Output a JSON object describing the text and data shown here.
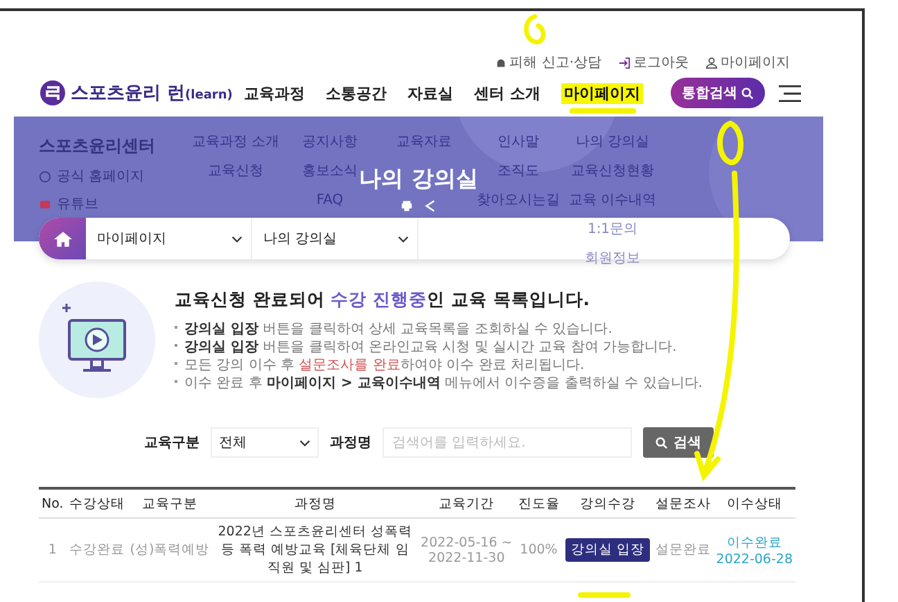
{
  "top_links": [
    {
      "label": "피해 신고·상담"
    },
    {
      "label": "로그아웃"
    },
    {
      "label": "마이페이지"
    }
  ],
  "logo": {
    "name": "스포츠윤리 런",
    "suffix": "(learn)"
  },
  "nav": [
    {
      "label": "교육과정",
      "selected": false
    },
    {
      "label": "소통공간",
      "selected": false
    },
    {
      "label": "자료실",
      "selected": false
    },
    {
      "label": "센터 소개",
      "selected": false
    },
    {
      "label": "마이페이지",
      "selected": true
    }
  ],
  "search_button": "통합검색",
  "banner": {
    "title": "나의 강의실"
  },
  "side_menu": {
    "title": "스포츠윤리센터",
    "items": [
      {
        "label": "공식 홈페이지"
      },
      {
        "label": "유튜브"
      }
    ]
  },
  "mega_menu": [
    [
      "교육과정 소개",
      "교육신청"
    ],
    [
      "공지사항",
      "홍보소식",
      "FAQ"
    ],
    [
      "교육자료"
    ],
    [
      "인사말",
      "조직도",
      "찾아오시는길"
    ],
    [
      "나의 강의실",
      "교육신청현황",
      "교육 이수내역",
      "1:1문의",
      "회원정보"
    ]
  ],
  "breadcrumb": [
    "마이페이지",
    "나의 강의실"
  ],
  "intro": {
    "title": [
      {
        "t": "교육신청 완료되어 ",
        "kind": "plain"
      },
      {
        "t": "수강 진행중",
        "kind": "accent"
      },
      {
        "t": "인 교육 목록입니다.",
        "kind": "plain"
      }
    ],
    "bullets": [
      [
        {
          "t": "강의실 입장",
          "kind": "bold"
        },
        {
          "t": " 버튼을 클릭하여 상세 교육목록을 조회하실 수 있습니다.",
          "kind": "plain"
        }
      ],
      [
        {
          "t": "강의실 입장",
          "kind": "bold"
        },
        {
          "t": " 버튼을 클릭하여 온라인교육 시청 및 실시간 교육 참여 가능합니다.",
          "kind": "plain"
        }
      ],
      [
        {
          "t": "모든 강의 이수 후 ",
          "kind": "plain"
        },
        {
          "t": "설문조사를 완료",
          "kind": "red"
        },
        {
          "t": "하여야 이수 완료 처리됩니다.",
          "kind": "plain"
        }
      ],
      [
        {
          "t": "이수 완료 후 ",
          "kind": "plain"
        },
        {
          "t": "마이페이지 > 교육이수내역",
          "kind": "bold"
        },
        {
          "t": " 메뉴에서 이수증을 출력하실 수 있습니다.",
          "kind": "plain"
        }
      ]
    ]
  },
  "filter": {
    "category_label": "교육구분",
    "category_value": "전체",
    "course_label": "과정명",
    "placeholder": "검색어를 입력하세요.",
    "button": "검색"
  },
  "table": {
    "columns": [
      "No.",
      "수강상태",
      "교육구분",
      "과정명",
      "교육기간",
      "진도율",
      "강의수강",
      "설문조사",
      "이수상태"
    ],
    "rows": [
      {
        "no": "1",
        "status": "수강완료",
        "category": "(성)폭력예방",
        "course": "2022년 스포츠윤리센터 성폭력 등 폭력 예방교육 [체육단체 임직원 및 심판] 1",
        "period": [
          "2022-05-16 ~",
          "2022-11-30"
        ],
        "progress": "100%",
        "enter": "강의실 입장",
        "survey": "설문완료",
        "completion": [
          "이수완료",
          "2022-06-28"
        ]
      }
    ]
  }
}
